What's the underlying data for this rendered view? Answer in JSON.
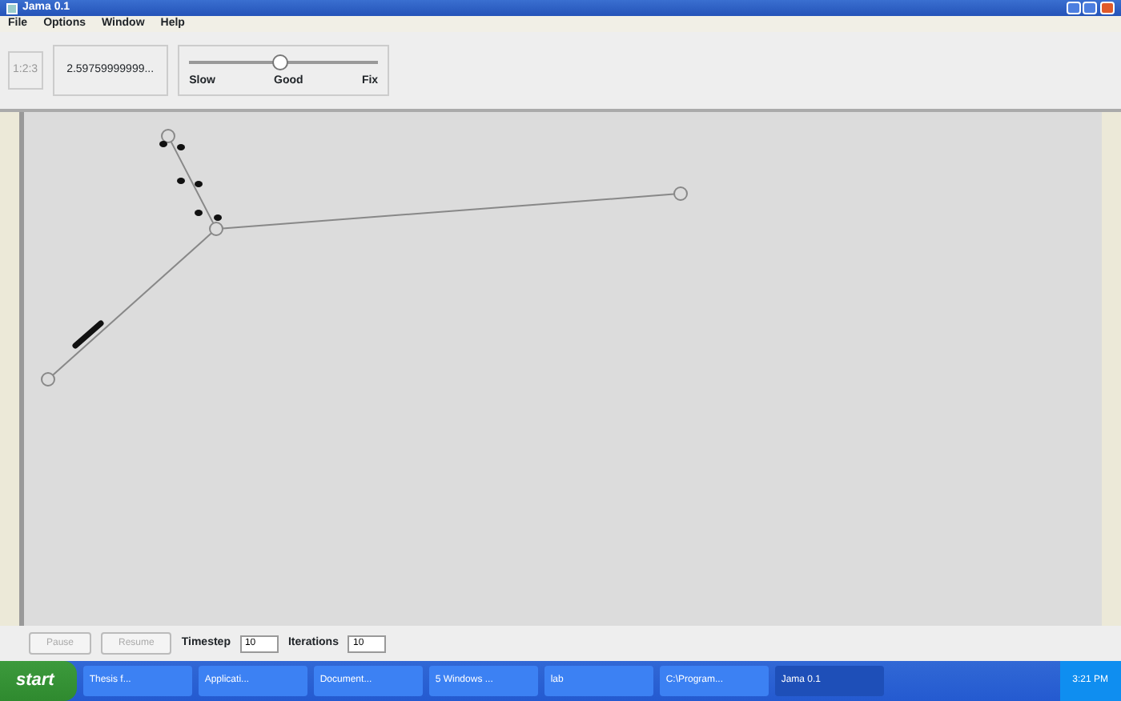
{
  "window": {
    "title": "Jama 0.1"
  },
  "menu": [
    "File",
    "Options",
    "Window",
    "Help"
  ],
  "toolbar": {
    "counter": "1:2:3",
    "value": "2.59759999999...",
    "slider": {
      "level": 0.48,
      "labels": [
        "Slow",
        "Good",
        "Fix"
      ]
    }
  },
  "controls": {
    "buttons": [
      {
        "label": "Pause",
        "disabled": true
      },
      {
        "label": "Resume",
        "disabled": true
      }
    ],
    "fields": [
      {
        "label": "Timestep",
        "value": "10"
      },
      {
        "label": "Iterations",
        "value": "10"
      }
    ]
  },
  "taskbar": {
    "start": "start",
    "items": [
      {
        "label": "Thesis f...",
        "selected": false
      },
      {
        "label": "Applicati...",
        "selected": false
      },
      {
        "label": "Document...",
        "selected": false
      },
      {
        "label": "5 Windows ...",
        "selected": false
      },
      {
        "label": "lab",
        "selected": false
      },
      {
        "label": "C:\\Program...",
        "selected": false
      },
      {
        "label": "Jama 0.1",
        "selected": true
      }
    ],
    "clock": "3:21 PM"
  }
}
